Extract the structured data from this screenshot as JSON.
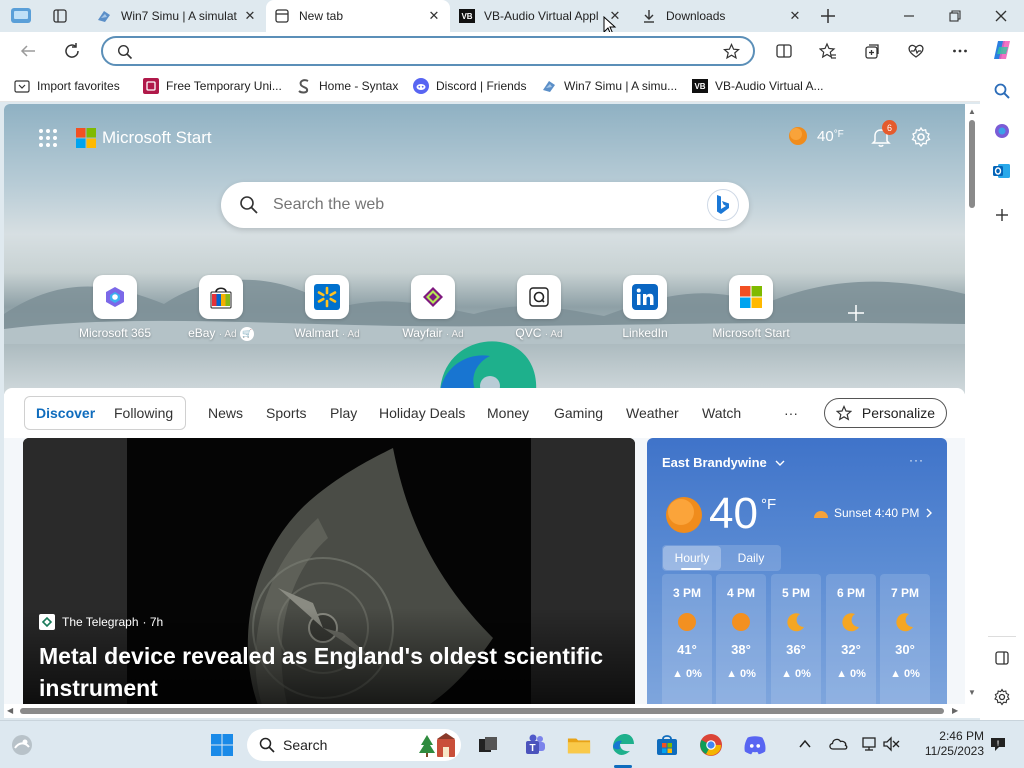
{
  "tabs": [
    {
      "title": "Win7 Simu | A simulat",
      "icon": "win7-favicon",
      "active": false
    },
    {
      "title": "New tab",
      "icon": "newtab-favicon",
      "active": true
    },
    {
      "title": "VB-Audio Virtual Appl",
      "icon": "vb-favicon",
      "active": false
    },
    {
      "title": "Downloads",
      "icon": "download-icon",
      "active": false
    }
  ],
  "address": {
    "value": "",
    "placeholder": ""
  },
  "favorites": [
    {
      "label": "Import favorites",
      "icon": "import-icon"
    },
    {
      "label": "Free Temporary Uni...",
      "icon": "temp-favicon"
    },
    {
      "label": "Home - Syntax",
      "icon": "syntax-favicon"
    },
    {
      "label": "Discord | Friends",
      "icon": "discord-favicon"
    },
    {
      "label": "Win7 Simu | A simu...",
      "icon": "win7-favicon"
    },
    {
      "label": "VB-Audio Virtual A...",
      "icon": "vb-favicon"
    }
  ],
  "header": {
    "brand": "Microsoft Start",
    "temp": "40",
    "temp_unit": "°F",
    "notifications": "6"
  },
  "search": {
    "placeholder": "Search the web"
  },
  "quick_links": [
    {
      "label": "Microsoft 365",
      "ad": ""
    },
    {
      "label": "eBay",
      "ad": "· Ad"
    },
    {
      "label": "Walmart",
      "ad": "· Ad"
    },
    {
      "label": "Wayfair",
      "ad": "· Ad"
    },
    {
      "label": "QVC",
      "ad": "· Ad"
    },
    {
      "label": "LinkedIn",
      "ad": ""
    },
    {
      "label": "Microsoft Start",
      "ad": ""
    }
  ],
  "feed_nav": {
    "discover": "Discover",
    "following": "Following",
    "items": [
      "News",
      "Sports",
      "Play",
      "Holiday Deals",
      "Money",
      "Gaming",
      "Weather",
      "Watch"
    ],
    "more": "···",
    "personalize": "Personalize"
  },
  "article": {
    "source": "The Telegraph",
    "age": "· 7h",
    "headline_line1": "Metal device revealed as England's oldest scientific",
    "headline_line2": "instrument"
  },
  "weather": {
    "location": "East Brandywine",
    "temp": "40",
    "unit": "°F",
    "sunset": "Sunset 4:40 PM",
    "tab_hourly": "Hourly",
    "tab_daily": "Daily",
    "hourly": [
      {
        "time": "3 PM",
        "temp": "41°",
        "precip": "0%",
        "icon": "sun"
      },
      {
        "time": "4 PM",
        "temp": "38°",
        "precip": "0%",
        "icon": "sun"
      },
      {
        "time": "5 PM",
        "temp": "36°",
        "precip": "0%",
        "icon": "moon"
      },
      {
        "time": "6 PM",
        "temp": "32°",
        "precip": "0%",
        "icon": "moon"
      },
      {
        "time": "7 PM",
        "temp": "30°",
        "precip": "0%",
        "icon": "moon"
      }
    ]
  },
  "taskbar": {
    "search_label": "Search",
    "time": "2:46 PM",
    "date": "11/25/2023"
  },
  "colors": {
    "accent": "#0f6cbd",
    "weather_bg": "#4a7fd0",
    "notif": "#c42b1c"
  }
}
